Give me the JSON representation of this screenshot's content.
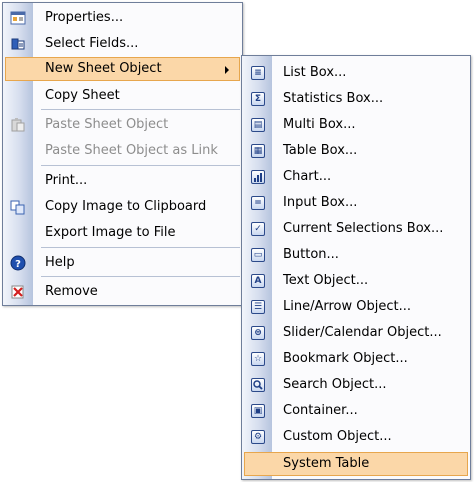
{
  "main_menu": {
    "properties": "Properties...",
    "select_fields": "Select Fields...",
    "new_sheet_object": "New Sheet Object",
    "copy_sheet": "Copy Sheet",
    "paste_sheet_object": "Paste Sheet Object",
    "paste_sheet_object_link": "Paste Sheet Object as Link",
    "print": "Print...",
    "copy_image": "Copy Image to Clipboard",
    "export_image": "Export Image to File",
    "help": "Help",
    "remove": "Remove"
  },
  "submenu": {
    "list_box": "List Box...",
    "statistics_box": "Statistics Box...",
    "multi_box": "Multi Box...",
    "table_box": "Table Box...",
    "chart": "Chart...",
    "input_box": "Input Box...",
    "current_selections_box": "Current Selections Box...",
    "button": "Button...",
    "text_object": "Text Object...",
    "line_arrow_object": "Line/Arrow Object...",
    "slider_calendar_object": "Slider/Calendar Object...",
    "bookmark_object": "Bookmark Object...",
    "search_object": "Search Object...",
    "container": "Container...",
    "custom_object": "Custom Object...",
    "system_table": "System Table"
  },
  "colors": {
    "highlight_bg": "#fbd7a8",
    "highlight_border": "#e7a64d",
    "icon_blue": "#1f3f86"
  },
  "icons": {
    "list_box": "list-glyph",
    "statistics_box": "sigma-glyph",
    "multi_box": "multi-glyph",
    "table_box": "table-glyph",
    "chart": "chart-glyph",
    "input_box": "equals-glyph",
    "current_selections_box": "check-glyph",
    "button": "button-glyph",
    "text_object": "A-glyph",
    "line_arrow_object": "lines-glyph",
    "slider_calendar_object": "slider-glyph",
    "bookmark_object": "star-glyph",
    "search_object": "magnifier-glyph",
    "container": "container-glyph",
    "custom_object": "gear-glyph"
  }
}
